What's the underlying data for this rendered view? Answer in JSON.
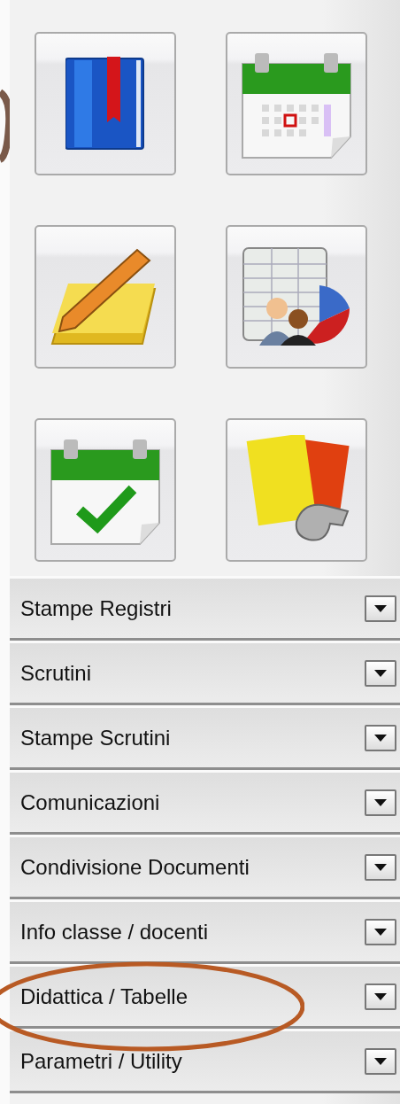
{
  "menu": [
    {
      "label": "Stampe Registri",
      "circled": false
    },
    {
      "label": "Scrutini",
      "circled": false
    },
    {
      "label": "Stampe Scrutini",
      "circled": false
    },
    {
      "label": "Comunicazioni",
      "circled": false
    },
    {
      "label": "Condivisione Documenti",
      "circled": false
    },
    {
      "label": "Info classe / docenti",
      "circled": false
    },
    {
      "label": "Didattica / Tabelle",
      "circled": true
    },
    {
      "label": "Parametri / Utility",
      "circled": false
    }
  ]
}
